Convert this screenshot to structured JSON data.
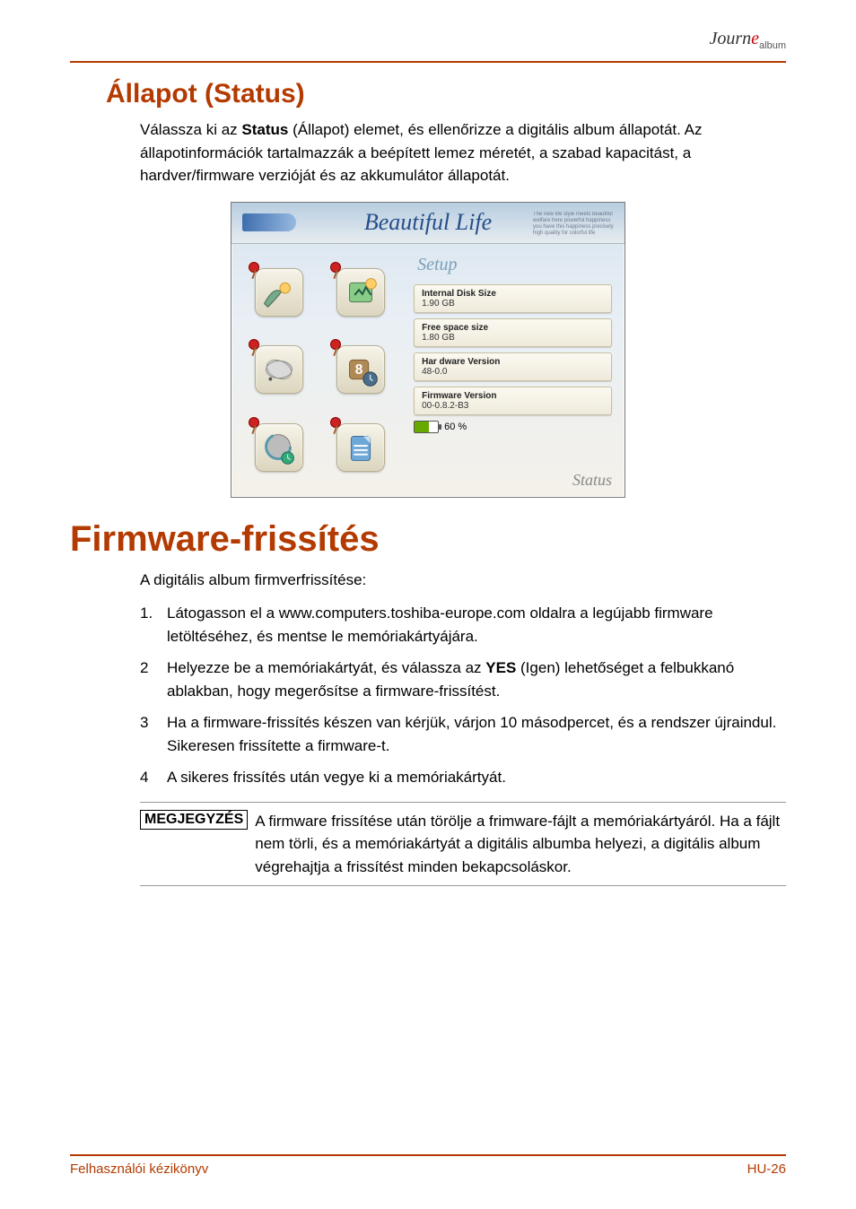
{
  "logo": {
    "script": "Journ",
    "accent": "e",
    "sub": "album"
  },
  "section_title": "Állapot (Status)",
  "status_para_pre": "Válassza ki az ",
  "status_bold": "Status",
  "status_para_post": " (Állapot) elemet, és ellenőrizze a digitális album állapotát. Az állapotinformációk tartalmazzák a beépített lemez méretét, a szabad kapacitást, a hardver/firmware verzióját és az akkumulátor állapotát.",
  "shot": {
    "header": "Beautiful Life",
    "tagline": "The new life style meets beautiful welfare here powerful happiness you have this happiness precisely high quality for colorful life",
    "setup": "Setup",
    "rows": [
      {
        "lbl": "Internal Disk Size",
        "val": "1.90 GB"
      },
      {
        "lbl": "Free space size",
        "val": "1.80 GB"
      },
      {
        "lbl": "Har dware Version",
        "val": "48-0.0"
      },
      {
        "lbl": "Firmware Version",
        "val": "00-0.8.2-B3"
      }
    ],
    "battery": "60 %",
    "status_label": "Status"
  },
  "main_heading": "Firmware-frissítés",
  "fw_intro": "A digitális album firmverfrissítése:",
  "steps": [
    {
      "n": "1.",
      "t": "Látogasson el a www.computers.toshiba-europe.com oldalra a legújabb firmware letöltéséhez, és mentse le memóriakártyájára."
    },
    {
      "n": "2",
      "pre": "Helyezze be a memóriakártyát, és válassza az ",
      "bold": "YES",
      "post": " (Igen) lehetőséget a felbukkanó ablakban, hogy megerősítse a firmware-frissítést."
    },
    {
      "n": "3",
      "t": "Ha a firmware-frissítés készen van kérjük, várjon 10 másodpercet, és a rendszer újraindul. Sikeresen frissítette a firmware-t."
    },
    {
      "n": "4",
      "t": "A sikeres frissítés után vegye ki a memóriakártyát."
    }
  ],
  "note_tag": "MEGJEGYZÉS",
  "note_text": "A firmware frissítése után törölje a frimware-fájlt a memóriakártyáról. Ha a fájlt nem törli, és a memóriakártyát a digitális albumba helyezi, a digitális album végrehajtja a frissítést minden bekapcsoláskor.",
  "footer_left": "Felhasználói kézikönyv",
  "footer_right": "HU-26"
}
